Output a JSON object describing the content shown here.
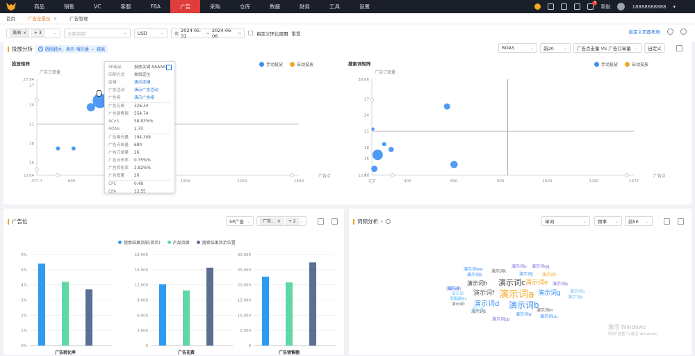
{
  "nav": {
    "items": [
      "商品",
      "销售",
      "VC",
      "客服",
      "FBA",
      "广告",
      "采购",
      "仓库",
      "数据",
      "财务",
      "工具",
      "设置"
    ],
    "active_index": 5,
    "help": "帮助",
    "username": "18888888888",
    "notification_count": "3"
  },
  "tabs": [
    {
      "label": "首页",
      "active": false,
      "closable": false
    },
    {
      "label": "广告全景仪",
      "active": true,
      "closable": true
    },
    {
      "label": "广告管理",
      "active": false,
      "closable": false
    }
  ],
  "filters": {
    "country_chip": "美国",
    "country_more": "+ 3",
    "shop_placeholder": "全部店铺",
    "currency": "USD",
    "date_start": "2024-05-31",
    "date_sep": "~",
    "date_end": "2024-06-06",
    "custom_compare": "自定义环比周期",
    "reset": "重置",
    "custom_page": "自定义页面布局"
  },
  "placement_panel": {
    "title": "投放分析",
    "hint": "圆圈越大，表示",
    "hint_metric": "曝光量",
    "hint_tail": "越高",
    "metric_select": "ROAS",
    "top_select": "前20",
    "compare_select": "广告点击量 VS 广告订单量",
    "custom_btn": "自定义",
    "legend": [
      {
        "name": "手动投放",
        "color": "#3b8ff3"
      },
      {
        "name": "自动投放",
        "color": "#f5a623"
      }
    ]
  },
  "chart_data": [
    {
      "type": "scatter",
      "title": "投放矩阵",
      "ylabel": "广告订单量",
      "xlabel": "广告点击量",
      "xlim": [
        477.7,
        1400
      ],
      "ylim": [
        13.04,
        27.94
      ],
      "x_ticks": [
        477.7,
        600,
        800,
        1000,
        1200,
        1400
      ],
      "y_ticks": [
        13.04,
        15,
        18,
        21,
        24,
        27,
        27.94
      ],
      "ref_x": 755,
      "ref_y": 21,
      "series": [
        {
          "name": "手动投放",
          "color": "#3b8ff3",
          "points": [
            [
              552,
              17.2,
              2
            ],
            [
              607,
              17.2,
              2
            ],
            [
              668,
              23.6,
              4
            ],
            [
              700,
              24.6,
              7
            ],
            [
              742,
              22.4,
              3
            ],
            [
              796,
              24.2,
              4
            ]
          ]
        },
        {
          "name": "自动投放",
          "color": "#f5a623",
          "points": []
        }
      ]
    },
    {
      "type": "scatter",
      "title": "搜索词矩阵",
      "ylabel": "广告订单量",
      "xlabel": "广告点击量",
      "xlim": [
        247,
        1372
      ],
      "ylim": [
        12.81,
        30.66
      ],
      "x_ticks": [
        247,
        400,
        600,
        800,
        1000,
        1200,
        1372
      ],
      "y_ticks": [
        12.81,
        13,
        16,
        18,
        21,
        24,
        27,
        30.66
      ],
      "ref_x": 830,
      "ref_y": 21,
      "series": [
        {
          "name": "手动投放",
          "color": "#3b8ff3",
          "points": [
            [
              252,
              21.4,
              1.5
            ],
            [
              258,
              14.0,
              3
            ],
            [
              272,
              16.6,
              5
            ],
            [
              300,
              18.6,
              2
            ],
            [
              330,
              17.6,
              2.5
            ],
            [
              570,
              25.6,
              3
            ],
            [
              600,
              14.8,
              3.5
            ]
          ]
        },
        {
          "name": "自动投放",
          "color": "#f5a623",
          "points": []
        }
      ]
    },
    {
      "type": "bar",
      "xlabel": "广告转化率",
      "categories": [
        "搜索结果顶部(首页)",
        "产品页面",
        "搜索结果其余位置"
      ],
      "values": [
        5.4,
        4.2,
        3.7
      ],
      "y_ticks": [
        "0%",
        "1%",
        "2%",
        "3%",
        "4%",
        "5%",
        "6%"
      ],
      "ylim": [
        0,
        6
      ]
    },
    {
      "type": "bar",
      "xlabel": "广告花费",
      "categories": [
        "搜索结果顶部(首页)",
        "产品页面",
        "搜索结果其余位置"
      ],
      "values": [
        12100,
        10900,
        15400
      ],
      "y_ticks": [
        "0",
        "3,000",
        "6,000",
        "9,000",
        "12,000",
        "15,000",
        "18,000"
      ],
      "ylim": [
        0,
        18000
      ]
    },
    {
      "type": "bar",
      "xlabel": "广告销售额",
      "categories": [
        "搜索结果顶部(首页)",
        "产品页面",
        "搜索结果其余位置"
      ],
      "values": [
        22700,
        20800,
        27400
      ],
      "y_ticks": [
        "0",
        "5,000",
        "10,000",
        "15,000",
        "20,000",
        "25,000",
        "30,000"
      ],
      "ylim": [
        0,
        30000
      ]
    }
  ],
  "tooltip": {
    "rows": [
      {
        "key": "SP商品",
        "value": "投放关键 AAAAA",
        "link": false
      },
      {
        "key": "匹配方式",
        "value": "类目定位",
        "link": false
      },
      {
        "key": "店铺",
        "value": "演示店铺",
        "link": true
      },
      {
        "key": "广告活动",
        "value": "演示广告活动",
        "link": true
      },
      {
        "key": "广告组",
        "value": "演示广告组",
        "link": true
      },
      {
        "key": "广告花费",
        "value": "326.34",
        "link": false,
        "sep": true
      },
      {
        "key": "广告销售额",
        "value": "554.74",
        "link": false
      },
      {
        "key": "ACoS",
        "value": "58.83%%",
        "link": false
      },
      {
        "key": "ROAS",
        "value": "1.70",
        "link": false
      },
      {
        "key": "广告曝光量",
        "value": "194,308",
        "link": false,
        "sep": true
      },
      {
        "key": "广告点击量",
        "value": "680",
        "link": false
      },
      {
        "key": "广告订单量",
        "value": "26",
        "link": false
      },
      {
        "key": "广告点击率",
        "value": "0.35%%",
        "link": false
      },
      {
        "key": "广告转化率",
        "value": "3.82%%",
        "link": false
      },
      {
        "key": "广告销量",
        "value": "26",
        "link": false
      },
      {
        "key": "CPC",
        "value": "0.48",
        "link": false,
        "sep": true
      },
      {
        "key": "CPA",
        "value": "12.55",
        "link": false
      }
    ]
  },
  "adpos_panel": {
    "title": "广告位",
    "type_select": "SP广告",
    "chip": "广告...",
    "chip_more": "+ 2",
    "legend": [
      {
        "name": "搜索结果顶部(首页)",
        "color": "#2f9bf0"
      },
      {
        "name": "产品页面",
        "color": "#5fd8a6"
      },
      {
        "name": "搜索结果其余位置",
        "color": "#5a6f91"
      }
    ]
  },
  "wordfreq_panel": {
    "title": "词频分析",
    "type_select": "单词",
    "metric_select": "频率",
    "top_select": "前50",
    "words": [
      {
        "text": "演示词a",
        "size": 14,
        "color": "#f5a623"
      },
      {
        "text": "演示词b",
        "size": 12,
        "color": "#3b8ff3"
      },
      {
        "text": "演示词c",
        "size": 11,
        "color": "#444"
      },
      {
        "text": "演示词d",
        "size": 10,
        "color": "#3b8ff3"
      },
      {
        "text": "演示词e",
        "size": 9,
        "color": "#f5a623"
      },
      {
        "text": "演示词f",
        "size": 9,
        "color": "#666"
      },
      {
        "text": "演示词g",
        "size": 9,
        "color": "#3b8ff3"
      },
      {
        "text": "演示词h",
        "size": 8,
        "color": "#444"
      },
      {
        "text": "演示词k",
        "size": 6,
        "color": "#666"
      },
      {
        "text": "演示词u",
        "size": 6,
        "color": "#7b6cd9"
      },
      {
        "text": "演示词qq",
        "size": 6,
        "color": "#7b6cd9"
      },
      {
        "text": "演示词ww",
        "size": 6,
        "color": "#3b8ff3"
      },
      {
        "text": "演示词e",
        "size": 6,
        "color": "#3b8ff3"
      },
      {
        "text": "演示词j",
        "size": 6,
        "color": "#3b8ff3"
      },
      {
        "text": "演示词r",
        "size": 6,
        "color": "#f5a623"
      },
      {
        "text": "演示词q",
        "size": 6,
        "color": "#7b6cd9"
      },
      {
        "text": "演示词o",
        "size": 6,
        "color": "#6bc0f0"
      },
      {
        "text": "演示词p",
        "size": 6,
        "color": "#6bc0f0"
      },
      {
        "text": "演示词i",
        "size": 5.5,
        "color": "#7b6cd9"
      },
      {
        "text": "演示词l",
        "size": 5.5,
        "color": "#6bc0f0"
      },
      {
        "text": "演示词n",
        "size": 5.5,
        "color": "#6bc0f0"
      },
      {
        "text": "演示词t",
        "size": 5.5,
        "color": "#666"
      },
      {
        "text": "演示词s",
        "size": 6,
        "color": "#666"
      },
      {
        "text": "演示词w",
        "size": 6,
        "color": "#3b8ff3"
      },
      {
        "text": "演示词pp",
        "size": 6,
        "color": "#7b6cd9"
      },
      {
        "text": "演示词y",
        "size": 5.5,
        "color": "#6bc0f0"
      },
      {
        "text": "演示词uu",
        "size": 6,
        "color": "#3b8ff3"
      },
      {
        "text": "演示词ii",
        "size": 5.5,
        "color": "#6bc0f0"
      },
      {
        "text": "演示词l",
        "size": 6,
        "color": "#3b8ff3"
      },
      {
        "text": "演示词m",
        "size": 6,
        "color": "#666"
      }
    ]
  },
  "watermark": {
    "line1": "激活 Windows",
    "line2": "转到\"设置\"以激活 Windows。"
  }
}
